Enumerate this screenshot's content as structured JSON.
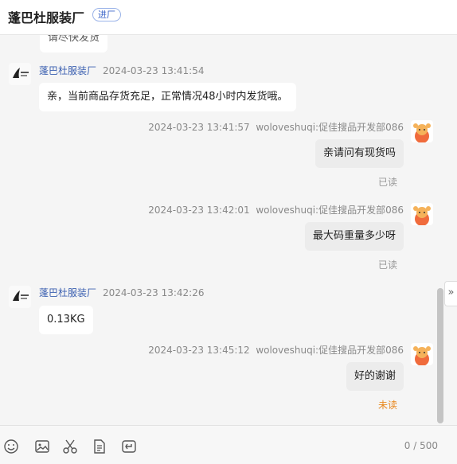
{
  "header": {
    "title": "蓬巴杜服装厂",
    "badge": "进厂"
  },
  "partial_top_message": "请尽快发货",
  "messages": [
    {
      "side": "left",
      "sender": "蓬巴杜服装厂",
      "time": "2024-03-23 13:41:54",
      "text": "亲，当前商品存货充足，正常情况48小时内发货哦。"
    },
    {
      "side": "right",
      "sender": "woloveshuqi:促佳搜品开发部086",
      "time": "2024-03-23 13:41:57",
      "text": "亲请问有现货吗",
      "status": "已读"
    },
    {
      "side": "right",
      "sender": "woloveshuqi:促佳搜品开发部086",
      "time": "2024-03-23 13:42:01",
      "text": "最大码重量多少呀",
      "status": "已读"
    },
    {
      "side": "left",
      "sender": "蓬巴杜服装厂",
      "time": "2024-03-23 13:42:26",
      "text": "0.13KG"
    },
    {
      "side": "right",
      "sender": "woloveshuqi:促佳搜品开发部086",
      "time": "2024-03-23 13:45:12",
      "text": "好的谢谢",
      "status": "未读"
    }
  ],
  "toolbar": {
    "icons": [
      "emoji-icon",
      "image-icon",
      "scissors-icon",
      "document-icon",
      "history-icon"
    ],
    "counter": "0 / 500"
  },
  "colors": {
    "unread": "#e8871e",
    "shop_name": "#3a5fb0",
    "badge": "#3a64c8"
  }
}
